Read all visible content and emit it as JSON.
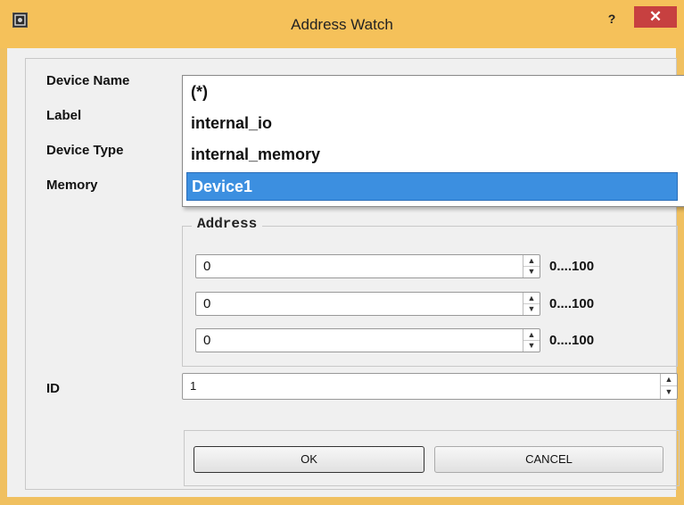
{
  "window": {
    "title": "Address Watch",
    "help_label": "?",
    "close_label": "✕",
    "icon": "app-icon"
  },
  "form": {
    "device_name_label": "Device Name",
    "label_label": "Label",
    "device_type_label": "Device Type",
    "memory_label": "Memory",
    "id_label": "ID",
    "id_value": "1"
  },
  "dropdown": {
    "options": [
      "(*)",
      "internal_io",
      "internal_memory",
      "Device1"
    ],
    "selected": "Device1"
  },
  "address": {
    "title": "Address",
    "fields": [
      {
        "value": "0",
        "range": "0....100"
      },
      {
        "value": "0",
        "range": "0....100"
      },
      {
        "value": "0",
        "range": "0....100"
      }
    ]
  },
  "buttons": {
    "ok": "OK",
    "cancel": "CANCEL"
  },
  "colors": {
    "title_bar": "#f5c15a",
    "close_button": "#c74040",
    "selection": "#3c8fe0"
  }
}
